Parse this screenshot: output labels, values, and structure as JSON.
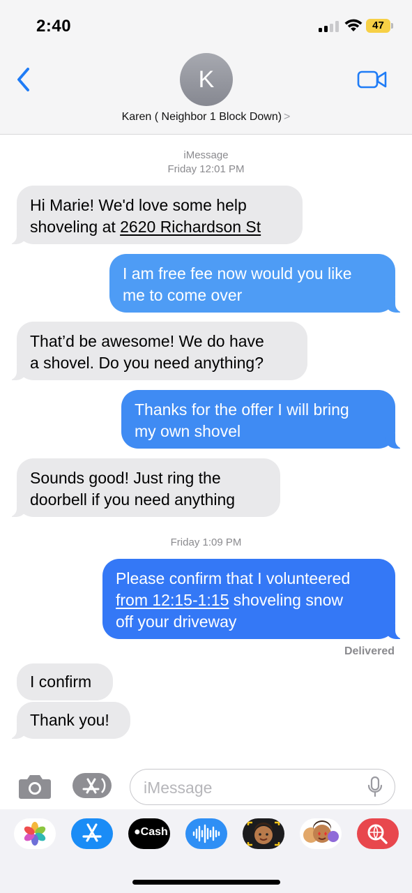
{
  "status_bar": {
    "time": "2:40",
    "battery": "47"
  },
  "header": {
    "avatar_initial": "K",
    "contact_name": "Karen ( Neighbor 1 Block Down)",
    "chevron": ">"
  },
  "thread": {
    "service_label": "iMessage",
    "timestamp_1": "Friday 12:01 PM",
    "timestamp_2": "Friday 1:09 PM",
    "delivered": "Delivered",
    "messages": [
      {
        "direction": "incoming",
        "line1": "Hi Marie! We'd love some help",
        "line2_plain": "shoveling at ",
        "line2_link": "2620 Richardson St"
      },
      {
        "direction": "outgoing",
        "line1": "I am free fee now would you like",
        "line2": "me to come over",
        "color": "#4e9cf5"
      },
      {
        "direction": "incoming",
        "line1": "That’d be awesome! We do have",
        "line2": "a shovel. Do you need anything?"
      },
      {
        "direction": "outgoing",
        "line1": "Thanks for the offer I will bring",
        "line2": "my own shovel",
        "color": "#3f8bf3"
      },
      {
        "direction": "incoming",
        "line1": "Sounds good! Just ring the",
        "line2": "doorbell if you need anything"
      },
      {
        "direction": "outgoing",
        "line1": "Please confirm that I volunteered",
        "line2_link": "from 12:15-1:15",
        "line2_plain": " shoveling snow",
        "line3": "off your driveway",
        "color": "#3478f6"
      },
      {
        "direction": "incoming",
        "text": "I confirm"
      },
      {
        "direction": "incoming",
        "text": "Thank you!"
      }
    ]
  },
  "composer": {
    "placeholder": "iMessage"
  },
  "app_drawer": {
    "items": [
      {
        "name": "Photos",
        "icon": "photos-icon"
      },
      {
        "name": "App Store",
        "icon": "app-store-icon"
      },
      {
        "name": "Cash",
        "label": "Cash",
        "icon": "apple-cash-icon"
      },
      {
        "name": "Audio",
        "icon": "audio-message-icon"
      },
      {
        "name": "Memoji",
        "icon": "memoji-icon"
      },
      {
        "name": "Memoji Stickers",
        "icon": "memoji-stickers-icon"
      },
      {
        "name": "Search",
        "icon": "web-search-icon"
      }
    ]
  },
  "colors": {
    "ios_blue": "#1f7cf6",
    "incoming_bubble": "#e9e9eb",
    "meta_gray": "#8a8a8e"
  }
}
